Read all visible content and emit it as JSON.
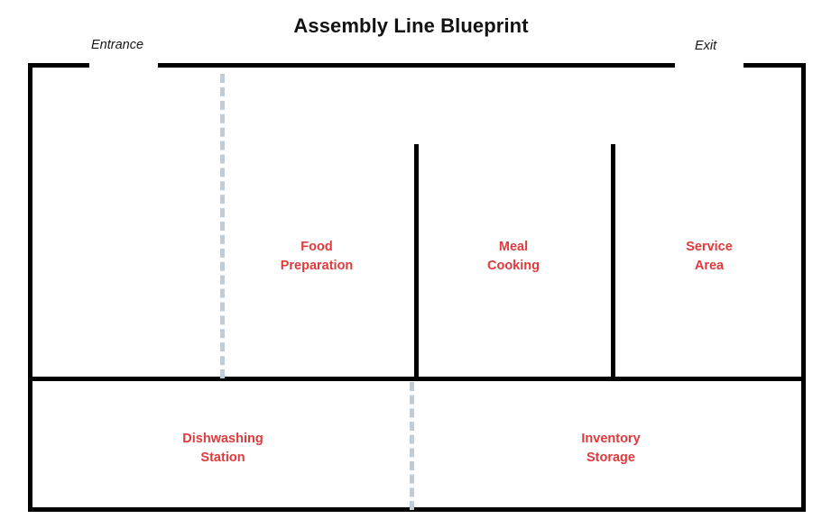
{
  "diagram": {
    "title": "Assembly Line Blueprint",
    "type": "floor-plan-blueprint",
    "colors": {
      "wall": "#000000",
      "zone_label": "#e03a3c",
      "flow_line": "#c3ccd4",
      "title": "#121212",
      "background": "#ffffff"
    }
  },
  "openings": [
    {
      "id": "entrance",
      "label": "Entrance",
      "wall": "top",
      "style": "italic"
    },
    {
      "id": "exit",
      "label": "Exit",
      "wall": "top",
      "style": "italic"
    }
  ],
  "zones": [
    {
      "id": "food-preparation",
      "label": "Food\nPreparation",
      "section": "upper"
    },
    {
      "id": "meal-cooking",
      "label": "Meal\nCooking",
      "section": "upper"
    },
    {
      "id": "service-area",
      "label": "Service\nArea",
      "section": "upper"
    },
    {
      "id": "dishwashing-station",
      "label": "Dishwashing\nStation",
      "section": "lower"
    },
    {
      "id": "inventory-storage",
      "label": "Inventory\nStorage",
      "section": "lower"
    }
  ],
  "flow_lines": [
    {
      "id": "upper-flow-divider",
      "orientation": "vertical",
      "section": "upper"
    },
    {
      "id": "lower-flow-divider",
      "orientation": "vertical",
      "section": "lower"
    }
  ]
}
